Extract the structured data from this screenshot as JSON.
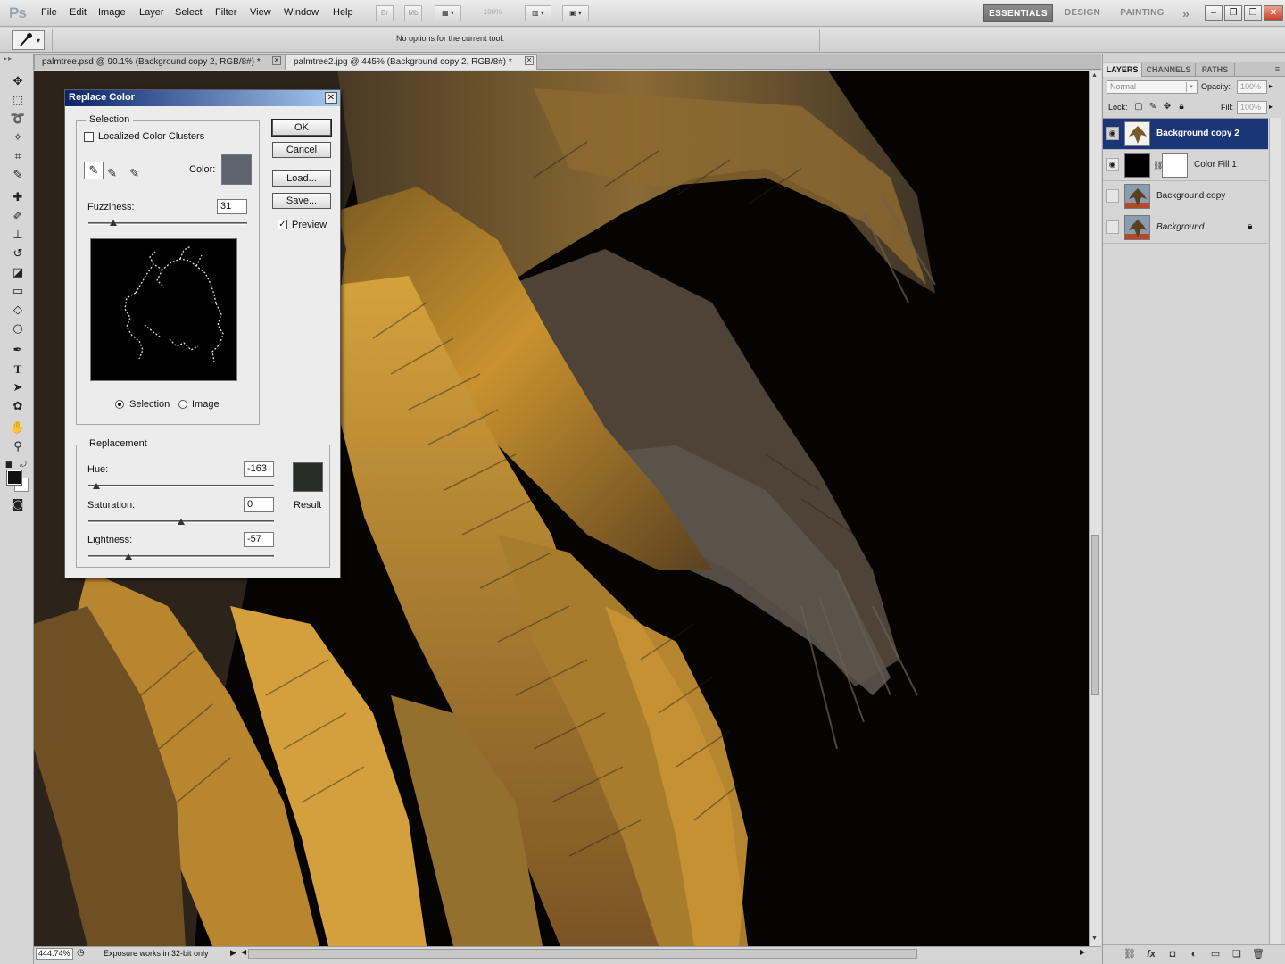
{
  "app": {
    "logo": "Ps"
  },
  "menu": [
    "File",
    "Edit",
    "Image",
    "Layer",
    "Select",
    "Filter",
    "View",
    "Window",
    "Help"
  ],
  "toolbar": {
    "bridge_label": "Br",
    "minibridge_label": "Mb",
    "zoom_value": "100%"
  },
  "workspaces": {
    "active": "ESSENTIALS",
    "design": "DESIGN",
    "painting": "PAINTING",
    "more": "»"
  },
  "window_buttons": {
    "minimize": "–",
    "restore": "❐",
    "close": "✕"
  },
  "options_bar": {
    "message": "No options for the current tool."
  },
  "tabs": [
    {
      "label": "palmtree.psd @ 90.1% (Background copy 2, RGB/8#) *"
    },
    {
      "label": "palmtree2.jpg @ 445% (Background copy 2, RGB/8#) *"
    }
  ],
  "tab_close_glyph": "✕",
  "status": {
    "zoom": "444.74%",
    "info": "Exposure works in 32-bit only"
  },
  "dialog": {
    "title": "Replace Color",
    "close_glyph": "✕",
    "selection_group": "Selection",
    "localized_label": "Localized Color Clusters",
    "localized_checked": false,
    "color_label": "Color:",
    "selection_color": "#5e6370",
    "fuzziness_label": "Fuzziness:",
    "fuzziness_value": "31",
    "view_selection_label": "Selection",
    "view_image_label": "Image",
    "replacement_group": "Replacement",
    "hue_label": "Hue:",
    "hue_value": "-163",
    "saturation_label": "Saturation:",
    "saturation_value": "0",
    "lightness_label": "Lightness:",
    "lightness_value": "-57",
    "result_label": "Result",
    "result_color": "#2a2c27",
    "buttons": {
      "ok": "OK",
      "cancel": "Cancel",
      "load": "Load...",
      "save": "Save..."
    },
    "preview_label": "Preview",
    "preview_checked": true
  },
  "panel": {
    "tabs": [
      "LAYERS",
      "CHANNELS",
      "PATHS"
    ],
    "menu_glyph": "≡",
    "blend_mode": "Normal",
    "opacity_label": "Opacity:",
    "opacity_value": "100%",
    "lock_label": "Lock:",
    "fill_label": "Fill:",
    "fill_value": "100%",
    "layers": [
      {
        "name": "Background copy 2",
        "visible": true,
        "selected": true
      },
      {
        "name": "Color Fill 1",
        "visible": true,
        "selected": false
      },
      {
        "name": "Background copy",
        "visible": false,
        "selected": false
      },
      {
        "name": "Background",
        "visible": false,
        "selected": false
      }
    ],
    "footer_icons": [
      "link-icon",
      "fx-icon",
      "mask-icon",
      "adjustment-icon",
      "group-icon",
      "new-layer-icon",
      "trash-icon"
    ]
  },
  "icons": {
    "tools": [
      "move-icon",
      "marquee-icon",
      "lasso-icon",
      "quick-select-icon",
      "crop-icon",
      "eyedropper-icon",
      "healing-icon",
      "brush-icon",
      "stamp-icon",
      "history-brush-icon",
      "eraser-icon",
      "gradient-icon",
      "blur-icon",
      "dodge-icon",
      "pen-icon",
      "type-icon",
      "path-select-icon",
      "shape-icon",
      "hand-icon",
      "zoom-icon"
    ]
  }
}
